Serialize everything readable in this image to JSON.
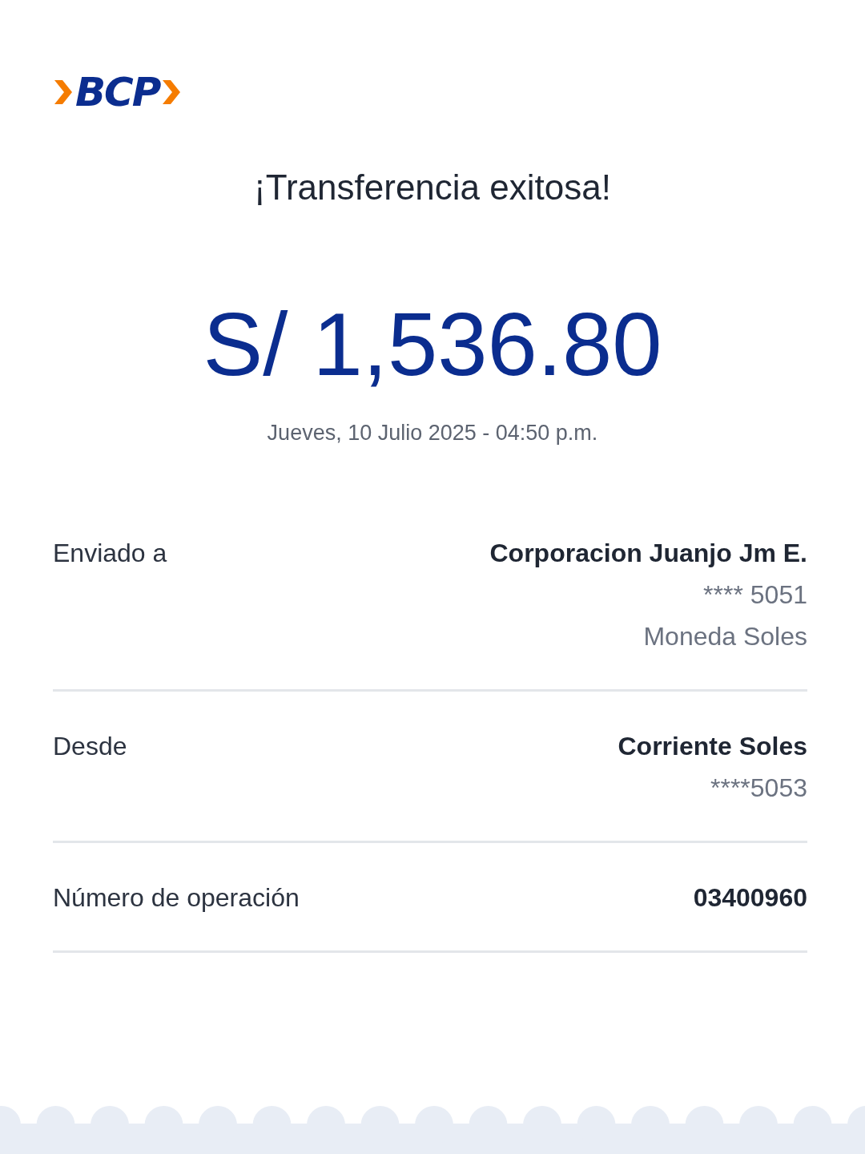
{
  "logo": {
    "text": "BCP"
  },
  "title": "¡Transferencia exitosa!",
  "amount": "S/ 1,536.80",
  "date": "Jueves, 10 Julio 2025 - 04:50 p.m.",
  "details": [
    {
      "label": "Enviado a",
      "values": [
        {
          "text": "Corporacion Juanjo Jm E.",
          "kind": "primary"
        },
        {
          "text": "**** 5051",
          "kind": "secondary"
        },
        {
          "text": "Moneda Soles",
          "kind": "secondary"
        }
      ]
    },
    {
      "label": "Desde",
      "values": [
        {
          "text": "Corriente Soles",
          "kind": "primary"
        },
        {
          "text": "****5053",
          "kind": "secondary"
        }
      ]
    },
    {
      "label": "Número de operación",
      "values": [
        {
          "text": "03400960",
          "kind": "primary"
        }
      ]
    }
  ]
}
